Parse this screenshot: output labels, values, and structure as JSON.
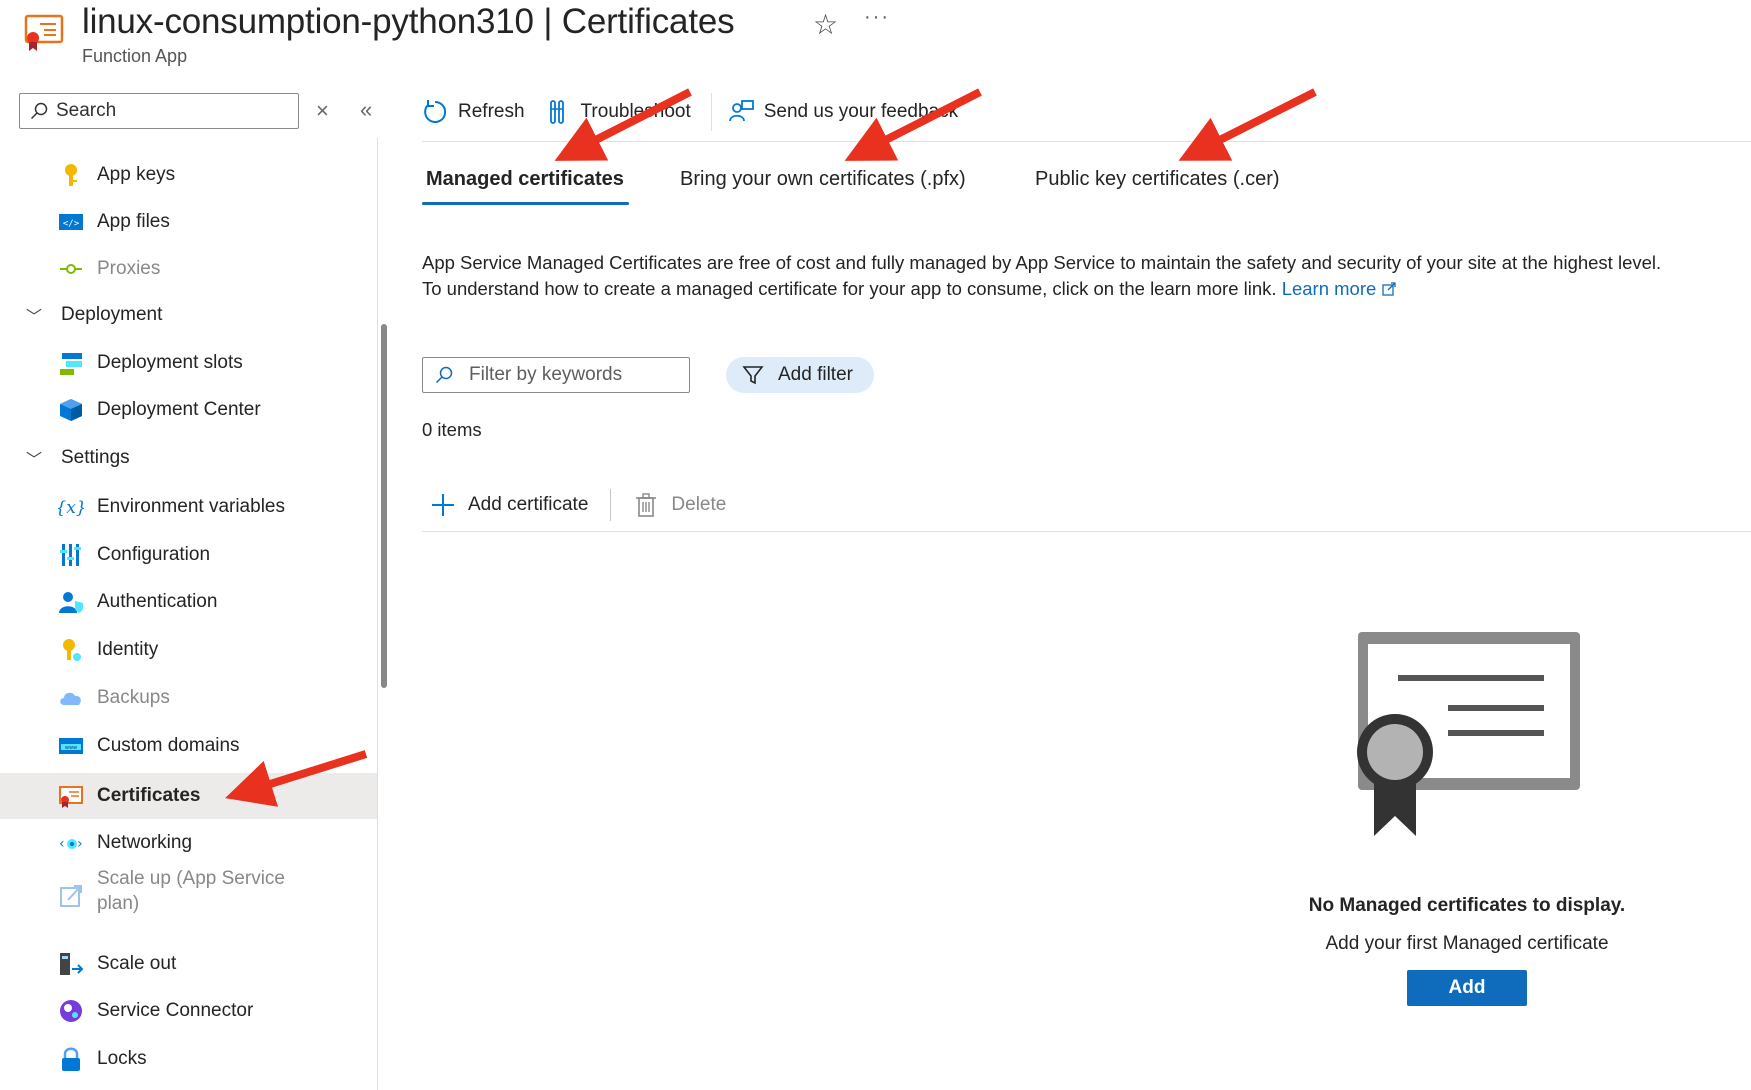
{
  "header": {
    "title": "linux-consumption-python310 | Certificates",
    "subtitle": "Function App"
  },
  "nav": {
    "search_label": "Search",
    "items": [
      {
        "label": "App keys",
        "icon": "key-icon",
        "disabled": false
      },
      {
        "label": "App files",
        "icon": "code-file-icon",
        "disabled": false
      },
      {
        "label": "Proxies",
        "icon": "proxy-icon",
        "disabled": true
      },
      {
        "label": "Deployment slots",
        "icon": "deployment-slots-icon",
        "disabled": false
      },
      {
        "label": "Deployment Center",
        "icon": "cube-icon",
        "disabled": false
      },
      {
        "label": "Environment variables",
        "icon": "variable-icon",
        "disabled": false
      },
      {
        "label": "Configuration",
        "icon": "sliders-icon",
        "disabled": false
      },
      {
        "label": "Authentication",
        "icon": "user-shield-icon",
        "disabled": false
      },
      {
        "label": "Identity",
        "icon": "identity-key-icon",
        "disabled": false
      },
      {
        "label": "Backups",
        "icon": "cloud-icon",
        "disabled": true
      },
      {
        "label": "Custom domains",
        "icon": "www-icon",
        "disabled": false
      },
      {
        "label": "Certificates",
        "icon": "certificate-icon",
        "disabled": false,
        "selected": true
      },
      {
        "label": "Networking",
        "icon": "network-icon",
        "disabled": false
      },
      {
        "label": "Scale up (App Service plan)",
        "line1": "Scale up (App Service",
        "line2": "plan)",
        "icon": "scale-up-icon",
        "disabled": true
      },
      {
        "label": "Scale out",
        "icon": "scale-out-icon",
        "disabled": false
      },
      {
        "label": "Service Connector",
        "icon": "service-connector-icon",
        "disabled": false
      },
      {
        "label": "Locks",
        "icon": "lock-icon",
        "disabled": false
      }
    ],
    "groups": [
      {
        "label": "Deployment"
      },
      {
        "label": "Settings"
      }
    ]
  },
  "toolbar": {
    "refresh": "Refresh",
    "troubleshoot": "Troubleshoot",
    "feedback": "Send us your feedback"
  },
  "tabs": [
    {
      "label": "Managed certificates",
      "active": true
    },
    {
      "label": "Bring your own certificates (.pfx)",
      "active": false
    },
    {
      "label": "Public key certificates (.cer)",
      "active": false
    }
  ],
  "description": {
    "line1": "App Service Managed Certificates are free of cost and fully managed by App Service to maintain the safety and security of your site at the highest level.",
    "line2": "To understand how to create a managed certificate for your app to consume, click on the learn more link.",
    "learn_more": "Learn more"
  },
  "filter": {
    "placeholder": "Filter by keywords",
    "add_filter": "Add filter"
  },
  "items_count": "0 items",
  "actions": {
    "add_certificate": "Add certificate",
    "delete": "Delete"
  },
  "empty_state": {
    "title": "No Managed certificates to display.",
    "subtitle": "Add your first Managed certificate",
    "button": "Add"
  },
  "colors": {
    "accent": "#0f6cbd",
    "annotation_arrow": "#e8311f",
    "selected_bg": "#edebe9"
  }
}
